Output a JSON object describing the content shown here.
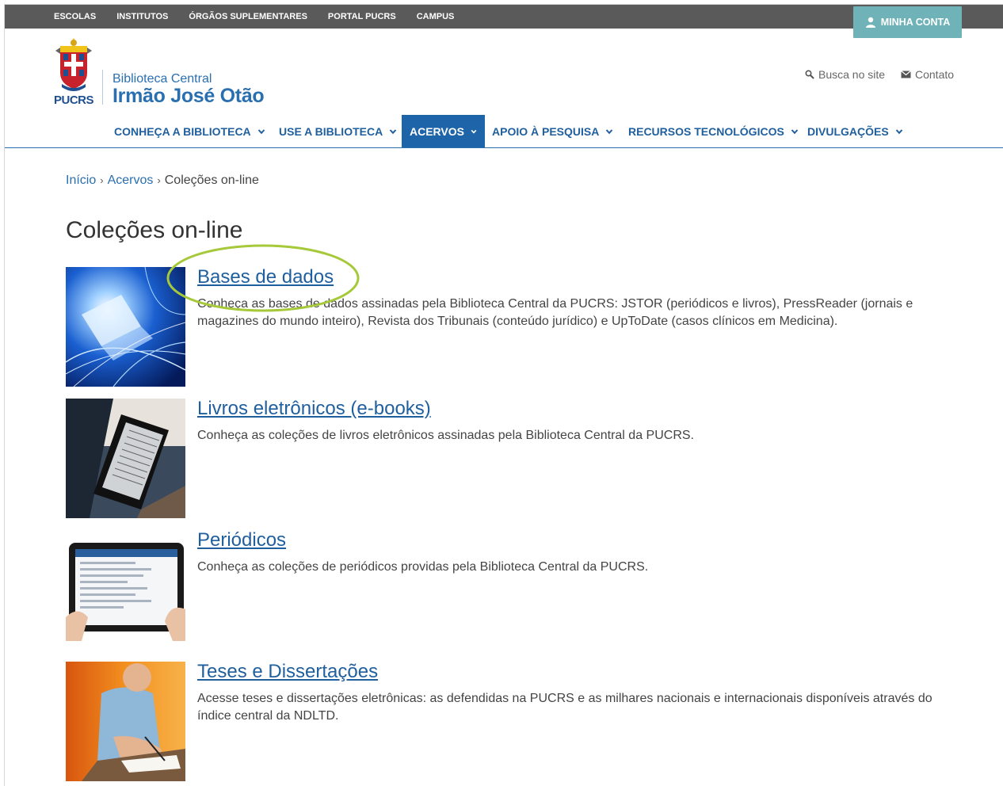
{
  "topbar": {
    "links": [
      "ESCOLAS",
      "INSTITUTOS",
      "ÓRGÃOS SUPLEMENTARES",
      "PORTAL PUCRS",
      "CAMPUS"
    ],
    "account_label": "MINHA CONTA"
  },
  "header": {
    "logo_text": "PUCRS",
    "site_name_small": "Biblioteca Central",
    "site_name_big": "Irmão José Otão",
    "search_label": "Busca no site",
    "contact_label": "Contato"
  },
  "nav": {
    "items": [
      {
        "label": "CONHEÇA A BIBLIOTECA"
      },
      {
        "label": "USE A BIBLIOTECA"
      },
      {
        "label": "ACERVOS"
      },
      {
        "label": "APOIO À PESQUISA"
      },
      {
        "label": "RECURSOS TECNOLÓGICOS"
      },
      {
        "label": "DIVULGAÇÕES"
      }
    ],
    "active_index": 2
  },
  "breadcrumb": {
    "items": [
      "Início",
      "Acervos"
    ],
    "current": "Coleções on-line"
  },
  "page_title": "Coleções on-line",
  "collections": [
    {
      "title": "Bases de dados",
      "description": "Conheça as bases de dados assinadas pela Biblioteca Central da PUCRS: JSTOR (periódicos e livros), PressReader (jornais e magazines do mundo inteiro), Revista dos Tribunais (conteúdo jurídico) e UpToDate (casos clínicos em Medicina).",
      "thumb_icon": "laptop-light-image"
    },
    {
      "title": "Livros eletrônicos (e-books)",
      "description": "Conheça as coleções de livros eletrônicos assinadas pela Biblioteca Central da PUCRS.",
      "thumb_icon": "ereader-image"
    },
    {
      "title": "Periódicos",
      "description": "Conheça as coleções de periódicos providas pela Biblioteca Central da PUCRS.",
      "thumb_icon": "tablet-image"
    },
    {
      "title": "Teses e Dissertações",
      "description": "Acesse teses e dissertações eletrônicas: as defendidas na PUCRS e as milhares nacionais e internacionais disponíveis através do índice central da NDLTD.",
      "thumb_icon": "person-writing-image"
    }
  ],
  "colors": {
    "topbar": "#5a5a5a",
    "account_button": "#6fb3b8",
    "brand_blue": "#1f5f9e",
    "nav_active": "#1e64a8",
    "annotation": "#a6c93a"
  }
}
